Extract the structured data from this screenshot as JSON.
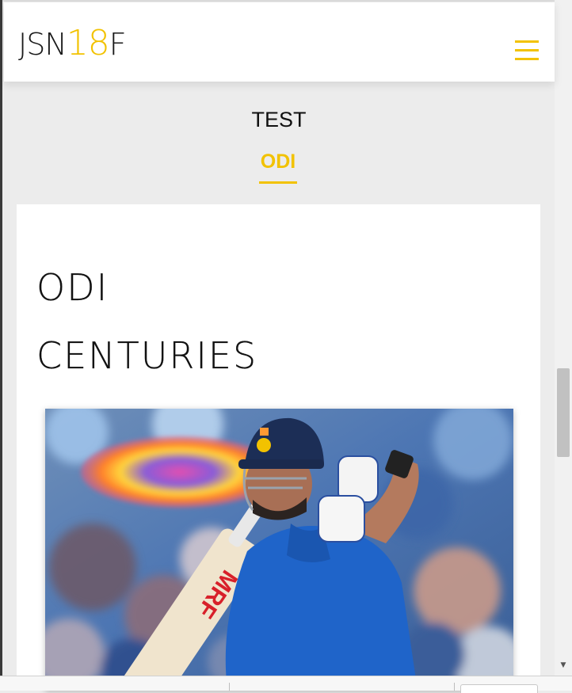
{
  "header": {
    "logo_part1": "JSN",
    "logo_part2": "18",
    "logo_part3": "F"
  },
  "tabs": [
    {
      "label": "TEST",
      "active": false
    },
    {
      "label": "ODI",
      "active": true
    }
  ],
  "section": {
    "title_line1": "ODI",
    "title_line2": "CENTURIES"
  },
  "bat_brand": "MRF",
  "colors": {
    "accent": "#f2c200",
    "text": "#111111",
    "page_bg": "#ececec",
    "card_bg": "#ffffff"
  }
}
